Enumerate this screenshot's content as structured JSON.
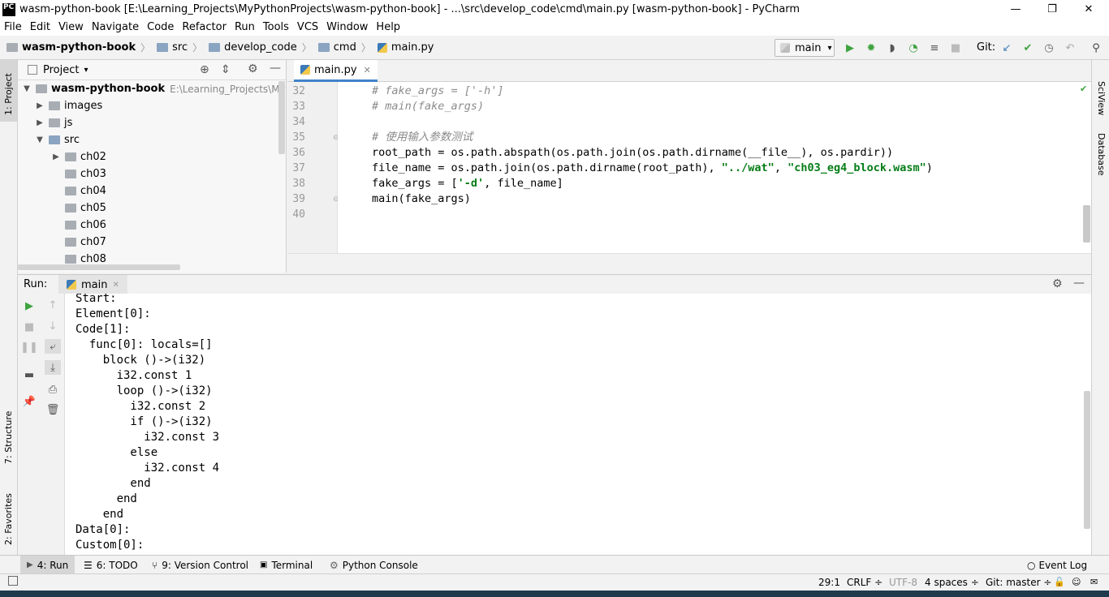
{
  "window": {
    "title": "wasm-python-book [E:\\Learning_Projects\\MyPythonProjects\\wasm-python-book] - ...\\src\\develop_code\\cmd\\main.py [wasm-python-book] - PyCharm",
    "app_icon": "PC",
    "minimize": "—",
    "maximize": "❐",
    "close": "✕"
  },
  "menu": [
    "File",
    "Edit",
    "View",
    "Navigate",
    "Code",
    "Refactor",
    "Run",
    "Tools",
    "VCS",
    "Window",
    "Help"
  ],
  "breadcrumb": [
    "wasm-python-book",
    "src",
    "develop_code",
    "cmd",
    "main.py"
  ],
  "toolbar": {
    "run_config": "main",
    "git_label": "Git:"
  },
  "project": {
    "header": "Project",
    "root_name": "wasm-python-book",
    "root_path": "E:\\Learning_Projects\\MyPytho",
    "items": [
      "images",
      "js",
      "src",
      "ch02",
      "ch03",
      "ch04",
      "ch05",
      "ch06",
      "ch07",
      "ch08"
    ]
  },
  "left_tabs": {
    "project": "1: Project",
    "structure": "7: Structure",
    "favorites": "2: Favorites"
  },
  "right_tabs": {
    "sciview": "SciView",
    "database": "Database"
  },
  "editor": {
    "tab": "main.py",
    "line_numbers": [
      "32",
      "33",
      "34",
      "35",
      "36",
      "37",
      "38",
      "39",
      "40"
    ],
    "lines": [
      {
        "c": "# fake_args = ['-h']"
      },
      {
        "c": "# main(fake_args)"
      },
      {
        "t": ""
      },
      {
        "c": "# 使用输入参数测试"
      },
      {
        "t": "root_path = os.path.abspath(os.path.join(os.path.dirname(__file__), os.pardir))"
      },
      {
        "a": "file_name = os.path.join(os.path.dirname(root_path), ",
        "s1": "\"../wat\"",
        "b": ", ",
        "s2": "\"ch03_eg4_block.wasm\"",
        "d": ")"
      },
      {
        "a": "fake_args = [",
        "s1": "'-d'",
        "b": ", file_name]"
      },
      {
        "t": "main(fake_args)"
      },
      {
        "t": ""
      }
    ]
  },
  "run": {
    "label": "Run:",
    "tab": "main",
    "output": [
      "Start:",
      "Element[0]:",
      "Code[1]:",
      "  func[0]: locals=[]",
      "    block ()->(i32)",
      "      i32.const 1",
      "      loop ()->(i32)",
      "        i32.const 2",
      "        if ()->(i32)",
      "          i32.const 3",
      "        else",
      "          i32.const 4",
      "        end",
      "      end",
      "    end",
      "Data[0]:",
      "Custom[0]:"
    ]
  },
  "bottom_tabs": {
    "run": "4: Run",
    "todo": "6: TODO",
    "vcs": "9: Version Control",
    "terminal": "Terminal",
    "python_console": "Python Console",
    "event_log": "Event Log"
  },
  "status": {
    "position": "29:1",
    "line_sep": "CRLF ÷",
    "encoding": "UTF-8",
    "indent": "4 spaces ÷",
    "git": "Git: master ÷"
  },
  "colors": {
    "accent": "#4083c9",
    "comment": "#8c8c8c",
    "string": "#067d17",
    "run_green": "#3fa33f"
  }
}
